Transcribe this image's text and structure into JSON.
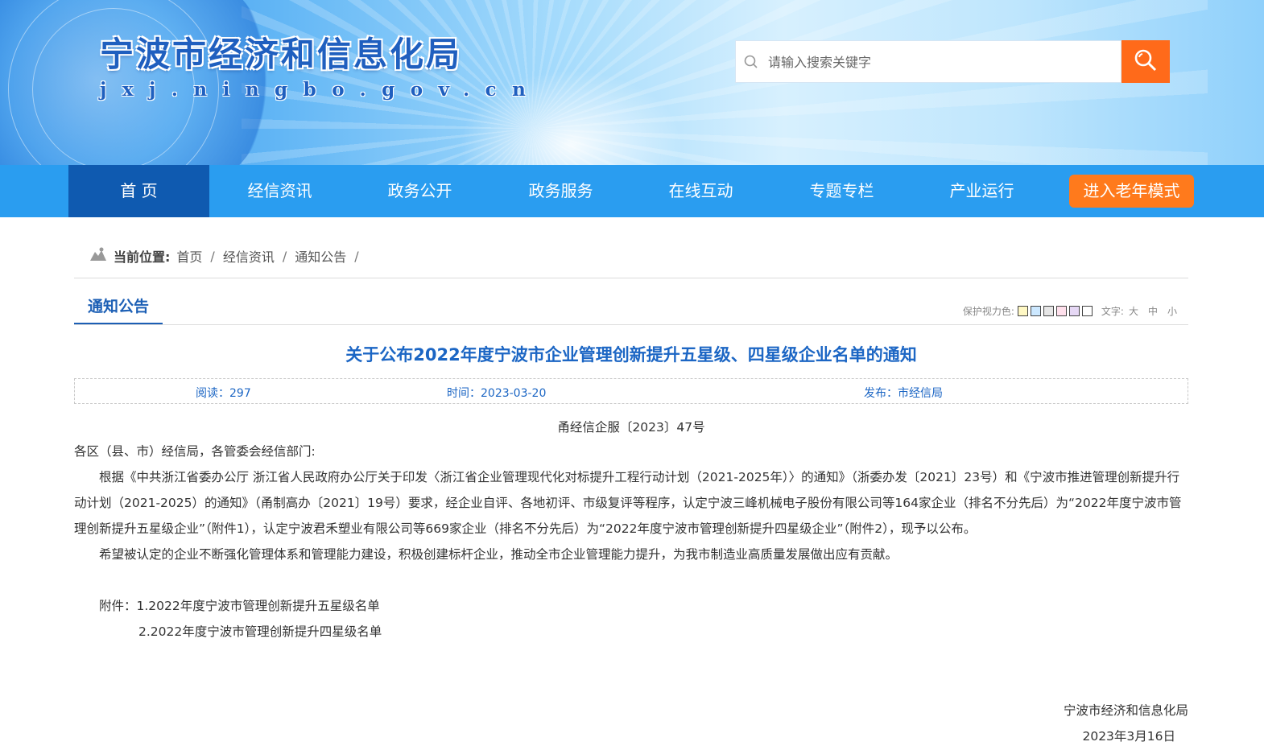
{
  "header": {
    "site_title": "宁波市经济和信息化局",
    "site_url": "jxj.ningbo.gov.cn",
    "search_placeholder": "请输入搜索关键字"
  },
  "nav": {
    "items": [
      {
        "label": "首 页",
        "active": true
      },
      {
        "label": "经信资讯"
      },
      {
        "label": "政务公开"
      },
      {
        "label": "政务服务"
      },
      {
        "label": "在线互动"
      },
      {
        "label": "专题专栏"
      },
      {
        "label": "产业运行"
      }
    ],
    "elder_mode_label": "进入老年模式"
  },
  "breadcrumb": {
    "label": "当前位置:",
    "items": [
      "首页",
      "经信资讯",
      "通知公告"
    ]
  },
  "column": {
    "title": "通知公告",
    "eye_color_label": "保护视力色:",
    "eye_colors": [
      "#fff8c4",
      "#cce8ff",
      "#e6e6e6",
      "#ffe0ec",
      "#e6d8f5",
      "#ffffff"
    ],
    "font_size_label": "文字:",
    "font_sizes": [
      "大",
      "中",
      "小"
    ]
  },
  "article": {
    "title": "关于公布2022年度宁波市企业管理创新提升五星级、四星级企业名单的通知",
    "reads": "阅读：297",
    "time": "时间：2023-03-20",
    "publisher": "发布：市经信局",
    "doc_number": "甬经信企服〔2023〕47号",
    "greeting": "各区（县、市）经信局，各管委会经信部门:",
    "para1": "根据《中共浙江省委办公厅 浙江省人民政府办公厅关于印发〈浙江省企业管理现代化对标提升工程行动计划（2021-2025年）〉的通知》（浙委办发〔2021〕23号）和《宁波市推进管理创新提升行动计划（2021-2025）的通知》（甬制高办〔2021〕19号）要求，经企业自评、各地初评、市级复评等程序，认定宁波三峰机械电子股份有限公司等164家企业（排名不分先后）为“2022年度宁波市管理创新提升五星级企业”（附件1），认定宁波君禾塑业有限公司等669家企业（排名不分先后）为“2022年度宁波市管理创新提升四星级企业”（附件2），现予以公布。",
    "para2": "希望被认定的企业不断强化管理体系和管理能力建设，积极创建标杆企业，推动全市企业管理能力提升，为我市制造业高质量发展做出应有贡献。",
    "attachment_1": "附件：1.2022年度宁波市管理创新提升五星级名单",
    "attachment_2": "2.2022年度宁波市管理创新提升四星级名单",
    "signature": "宁波市经济和信息化局",
    "date": "2023年3月16日"
  }
}
